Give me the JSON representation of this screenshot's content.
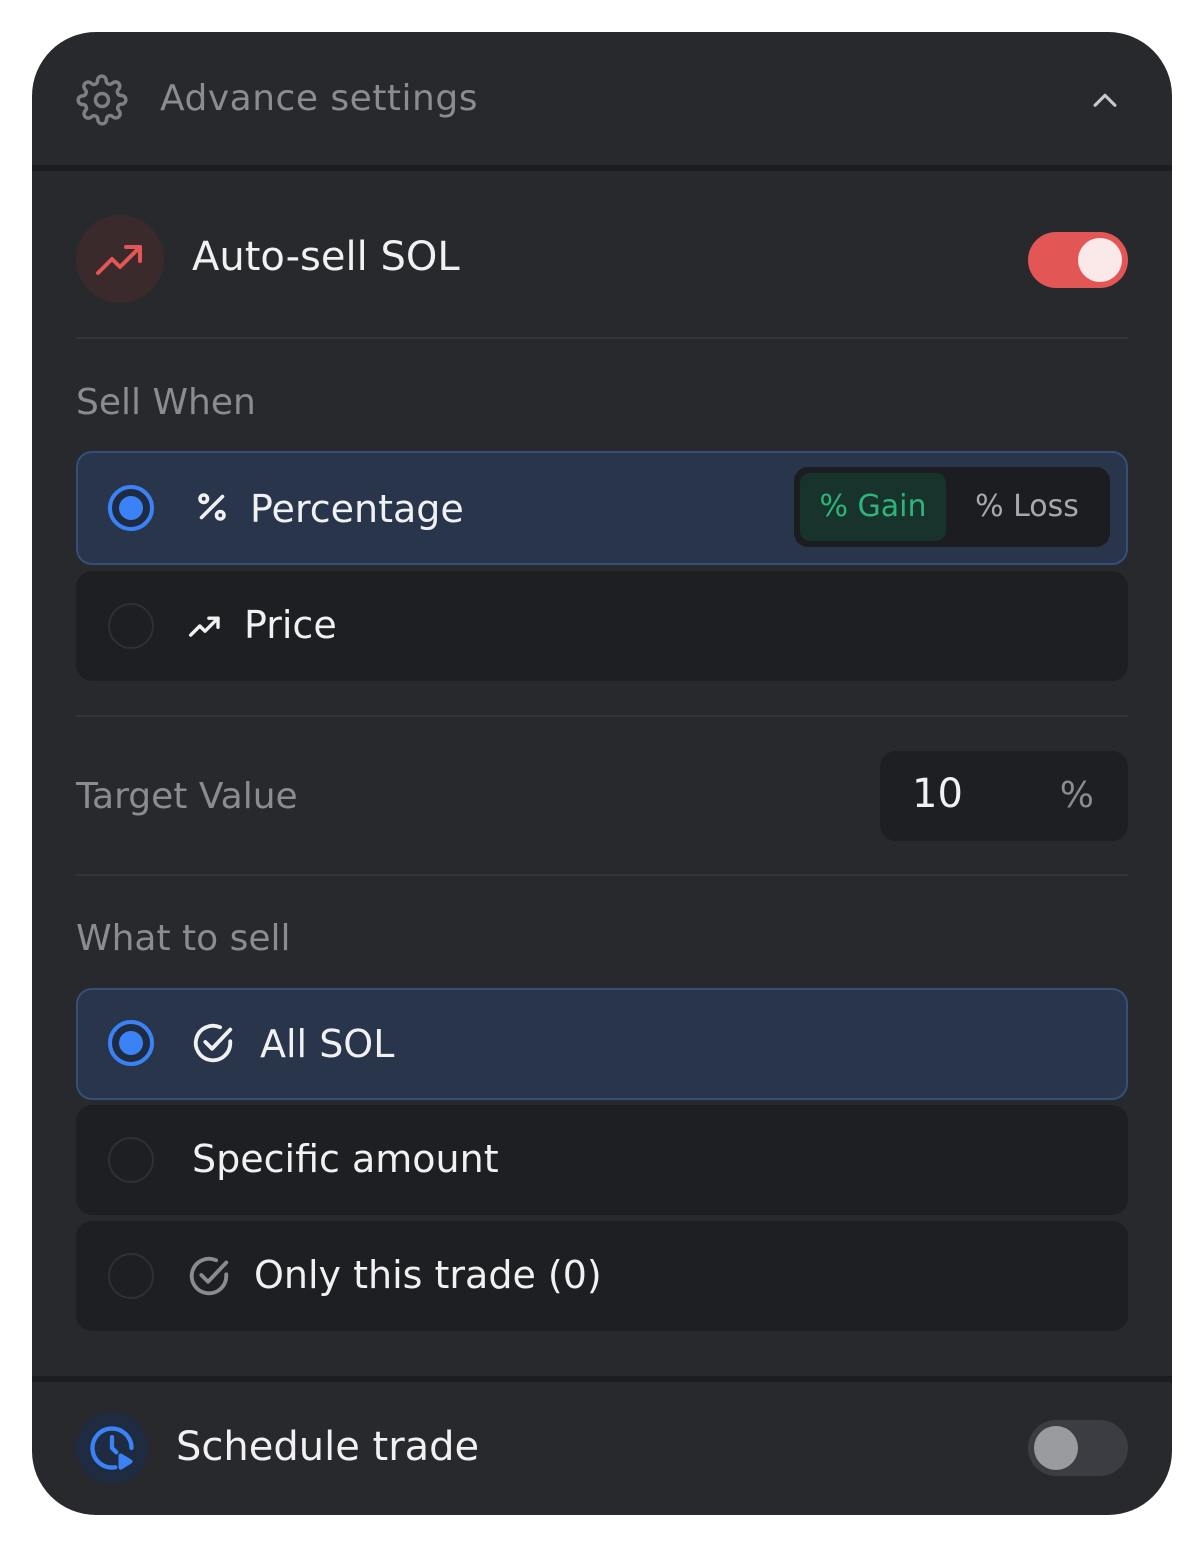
{
  "header": {
    "title": "Advance settings"
  },
  "autosell": {
    "title": "Auto-sell SOL",
    "enabled": true
  },
  "sell_when": {
    "label": "Sell When",
    "options": [
      {
        "label": "Percentage",
        "selected": true
      },
      {
        "label": "Price",
        "selected": false
      }
    ],
    "mode": {
      "gain_label": "% Gain",
      "loss_label": "% Loss",
      "active": "gain"
    }
  },
  "target": {
    "label": "Target Value",
    "value": "10",
    "unit": "%"
  },
  "what_to_sell": {
    "label": "What to sell",
    "options": [
      {
        "label": "All SOL",
        "selected": true
      },
      {
        "label": "Specific amount",
        "selected": false
      },
      {
        "label": "Only this trade (0)",
        "selected": false
      }
    ]
  },
  "schedule": {
    "title": "Schedule trade",
    "enabled": false
  },
  "colors": {
    "accent_blue": "#3b82f6",
    "toggle_on": "#e35656",
    "gain_green": "#2eb47a"
  }
}
